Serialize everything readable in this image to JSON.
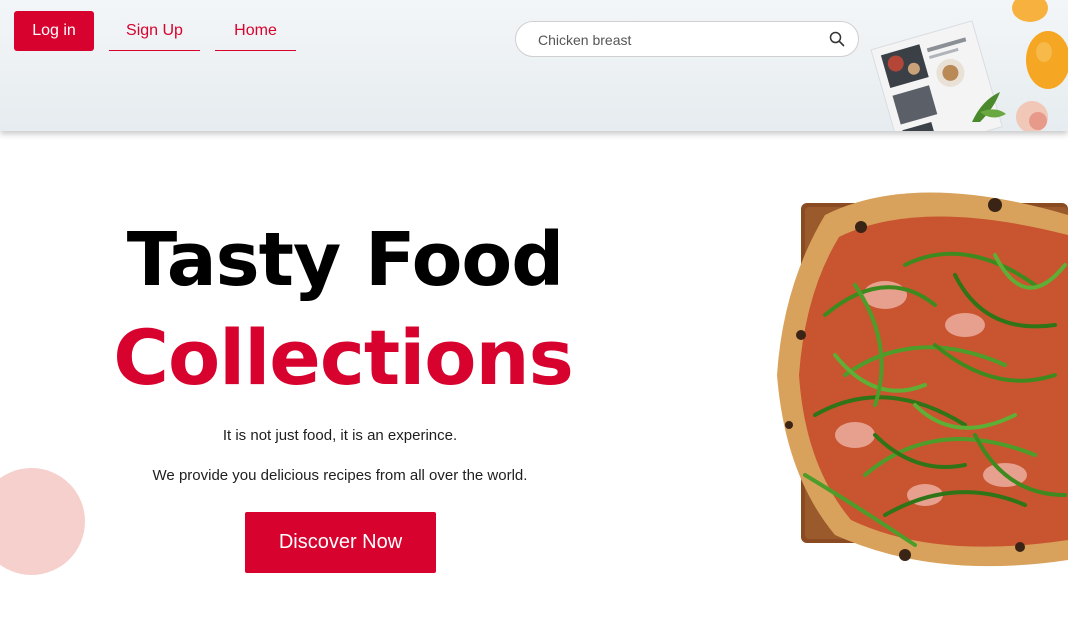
{
  "header": {
    "login_label": "Log in",
    "signup_label": "Sign Up",
    "home_label": "Home",
    "search": {
      "value": "",
      "placeholder": "Chicken breast"
    }
  },
  "hero": {
    "title_line1": "Tasty Food",
    "title_line2": "Collections",
    "tagline1": "It is not just food, it is an experince.",
    "tagline2": "We provide you delicious recipes from all over the world.",
    "cta_label": "Discover Now"
  },
  "colors": {
    "accent": "#d8022e",
    "decor_circle": "#f6d0cd",
    "header_bg": "#eef2f4"
  },
  "icons": [
    "search-icon"
  ]
}
